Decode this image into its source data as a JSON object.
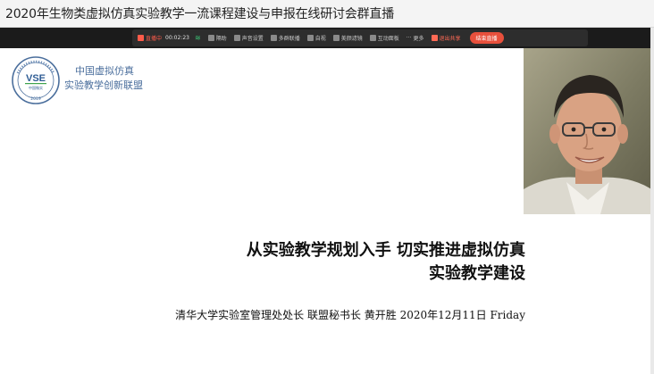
{
  "window": {
    "title": "2020年生物类虚拟仿真实验教学一流课程建设与申报在线研讨会群直播"
  },
  "toolbar": {
    "live_label": "直播中",
    "timer": "00:02:23",
    "items": [
      "隔助",
      "声音设置",
      "多群联播",
      "自视",
      "美颜滤镜",
      "互动面板",
      "更多"
    ],
    "stop_share_label": "退出共享",
    "end_live_label": "结束直播",
    "colors": {
      "live": "#ff5b4a",
      "end_button": "#e8503c",
      "signal": "#3bbf73"
    }
  },
  "slide": {
    "logo": {
      "emblem_text": "VSE",
      "emblem_sub": "中国微实",
      "emblem_year": "2019",
      "name_line1": "中国虚拟仿真",
      "name_line2": "实验教学创新联盟"
    },
    "title_line1": "从实验教学规划入手  切实推进虚拟仿真",
    "title_line2": "实验教学建设",
    "subtitle": "清华大学实验室管理处处长  联盟秘书长  黄开胜  2020年12月11日 Friday"
  }
}
